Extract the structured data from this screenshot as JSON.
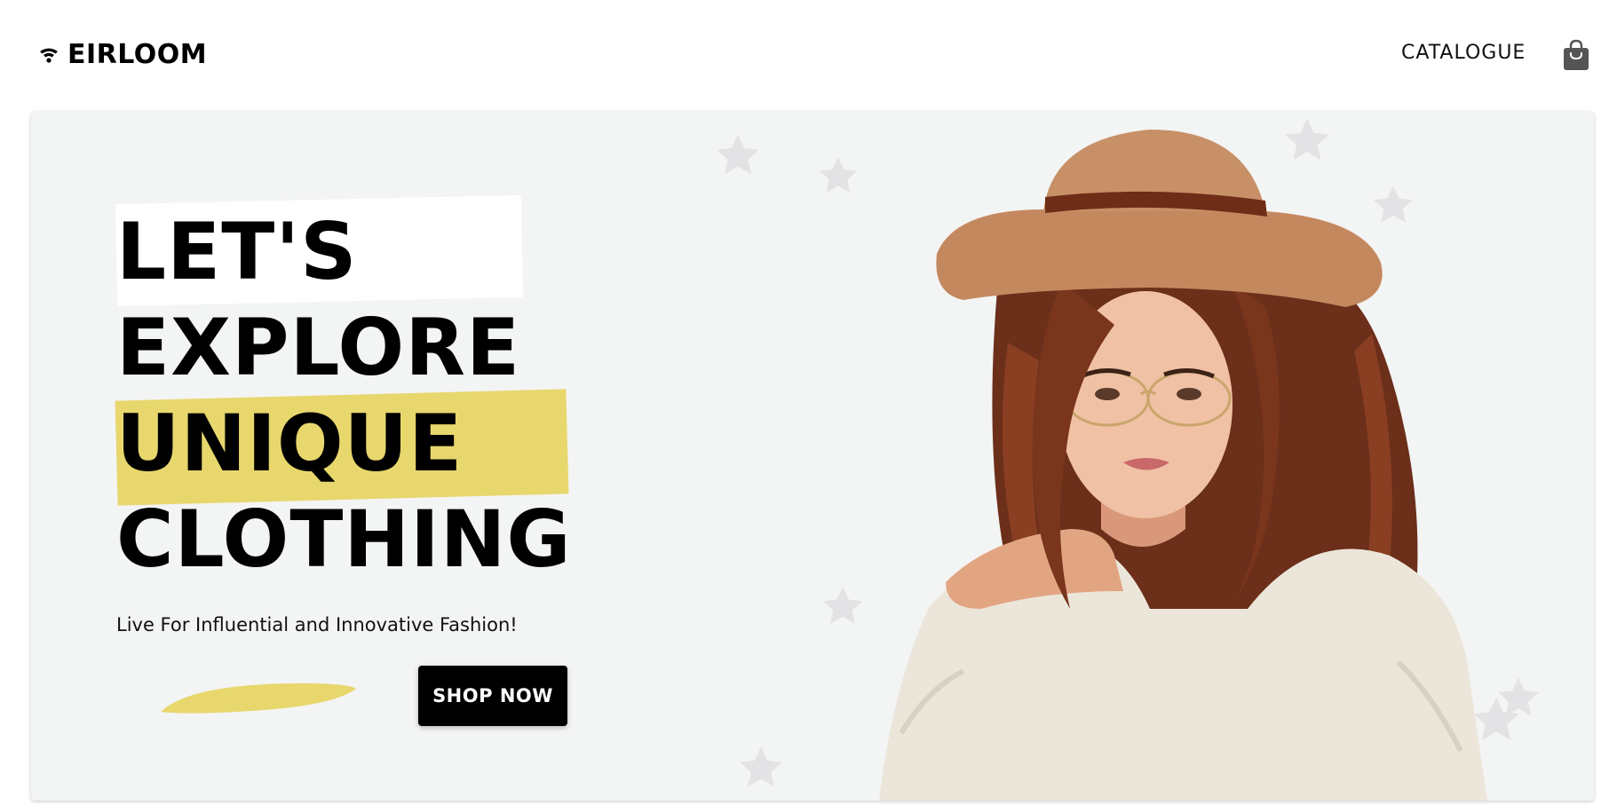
{
  "brand": {
    "name": "EIRLOOM",
    "icon": "wifi-icon"
  },
  "nav": {
    "links": [
      {
        "label": "CATALOGUE"
      }
    ],
    "cart_icon": "shopping-bag-icon"
  },
  "hero": {
    "headline": [
      "LET'S",
      "EXPLORE",
      "UNIQUE",
      "CLOTHING"
    ],
    "subtitle": "Live For Influential and Innovative Fashion!",
    "cta_label": "SHOP NOW",
    "image": "woman-in-hat-and-glasses",
    "accent_color": "#e8d76d",
    "background_color": "#f3f4f4"
  }
}
